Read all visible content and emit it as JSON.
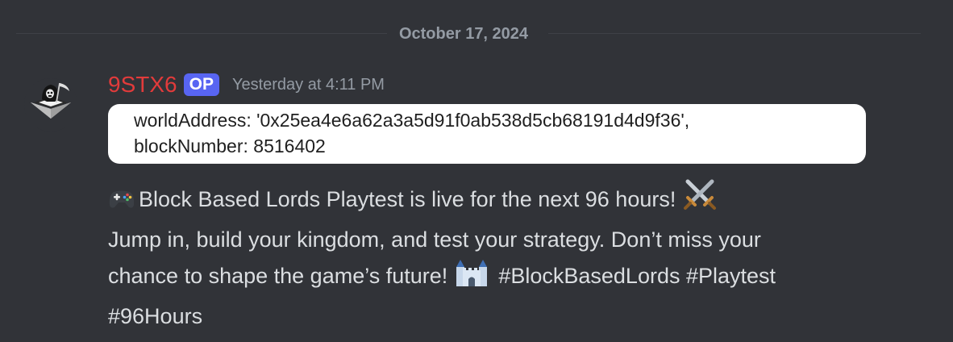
{
  "divider": {
    "date": "October 17, 2024"
  },
  "message": {
    "author": "9STX6",
    "badge": "OP",
    "timestamp": "Yesterday at 4:11 PM",
    "code_lines": [
      "worldAddress: '0x25ea4e6a62a3a5d91f0ab538d5cb68191d4d9f36',",
      "blockNumber: 8516402"
    ],
    "text_line1": "Block Based Lords Playtest is live for the next 96 hours!",
    "text_line2": "Jump in, build your kingdom, and test your strategy. Don’t miss your",
    "text_line3a": "chance to shape the game’s future!",
    "text_line3b": "#BlockBasedLords #Playtest",
    "text_line4": "#96Hours",
    "emojis": [
      "game-controller-icon",
      "crossed-swords-icon",
      "castle-icon"
    ]
  },
  "colors": {
    "background": "#313338",
    "username": "#e23b3b",
    "badge": "#5865f2",
    "muted": "#949ba4",
    "text": "#dbdee1"
  }
}
